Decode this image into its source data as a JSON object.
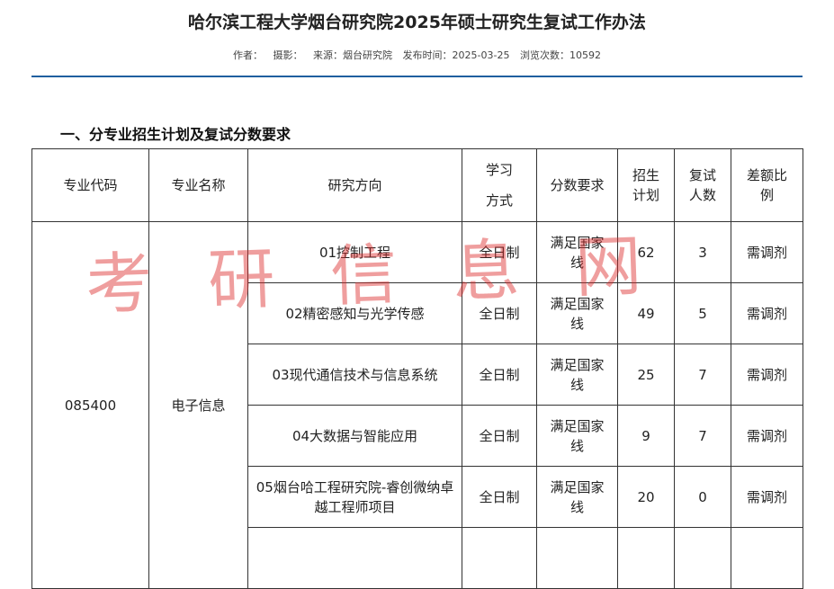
{
  "article": {
    "title": "哈尔滨工程大学烟台研究院2025年硕士研究生复试工作办法",
    "meta": {
      "author_label": "作者：",
      "photo_label": "摄影：",
      "source": "来源：烟台研究院",
      "published": "发布时间：2025-03-25",
      "views": "浏览次数：10592"
    },
    "section_heading": "一、分专业招生计划及复试分数要求"
  },
  "table": {
    "headers": {
      "code": "专业代码",
      "name": "专业名称",
      "direction": "研究方向",
      "mode": "学习方式",
      "score": "分数要求",
      "plan": "招生计划",
      "retest": "复试人数",
      "ratio": "差额比例"
    },
    "group": {
      "code": "085400",
      "name": "电子信息"
    },
    "rows": [
      {
        "direction": "01控制工程",
        "mode": "全日制",
        "score": "满足国家线",
        "plan": "62",
        "retest": "3",
        "ratio": "需调剂"
      },
      {
        "direction": "02精密感知与光学传感",
        "mode": "全日制",
        "score": "满足国家线",
        "plan": "49",
        "retest": "5",
        "ratio": "需调剂"
      },
      {
        "direction": "03现代通信技术与信息系统",
        "mode": "全日制",
        "score": "满足国家线",
        "plan": "25",
        "retest": "7",
        "ratio": "需调剂"
      },
      {
        "direction": "04大数据与智能应用",
        "mode": "全日制",
        "score": "满足国家线",
        "plan": "9",
        "retest": "7",
        "ratio": "需调剂"
      },
      {
        "direction": "05烟台哈工程研究院-睿创微纳卓越工程师项目",
        "mode": "全日制",
        "score": "满足国家线",
        "plan": "20",
        "retest": "0",
        "ratio": "需调剂"
      }
    ]
  },
  "watermark": "考研信息网",
  "colors": {
    "rule": "#1f5f9f",
    "watermark": "#dc2828"
  }
}
